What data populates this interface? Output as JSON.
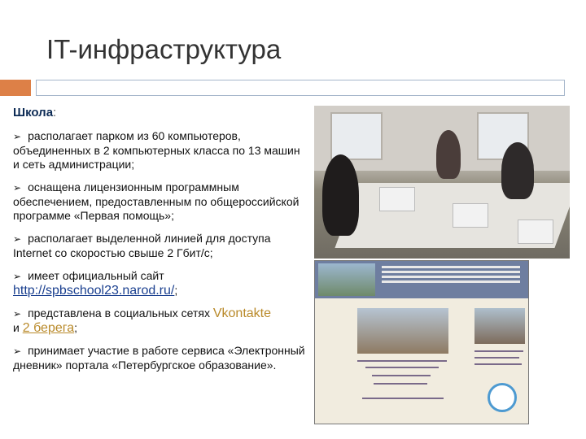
{
  "slide": {
    "title": "IT-инфраструктура",
    "colors": {
      "accent": "#dd8047",
      "line": "#a5b6cb",
      "heading": "#0d2b55",
      "link": "#1a3f8f",
      "link_alt": "#b98a2a"
    }
  },
  "content": {
    "heading": "Школа",
    "heading_colon": ":",
    "bullet_icon": "arrow-bullet-icon",
    "bullets": [
      {
        "text": "располагает парком из 60 компьютеров, объединенных в 2 компьютерных класса по 13 машин и сеть администрации;"
      },
      {
        "text": "оснащена лицензионным программным обеспечением, предоставленным по общероссийской программе «Первая помощь»;"
      },
      {
        "text": "располагает выделенной линией для доступа Internet со скоростью свыше 2 Гбит/с;"
      },
      {
        "text": "имеет официальный сайт",
        "link": "http://spbschool23.narod.ru/",
        "suffix": ";"
      },
      {
        "text": "представлена в социальных сетях",
        "link1": "Vkontakte",
        "middle": "и",
        "link2": "2 берега",
        "suffix": ";"
      },
      {
        "text": "принимает участие в работе сервиса «Электронный дневник» портала «Петербургское образование»."
      }
    ]
  },
  "images": {
    "classroom_photo": "classroom-photo",
    "website_screenshot": "school-website-screenshot"
  }
}
